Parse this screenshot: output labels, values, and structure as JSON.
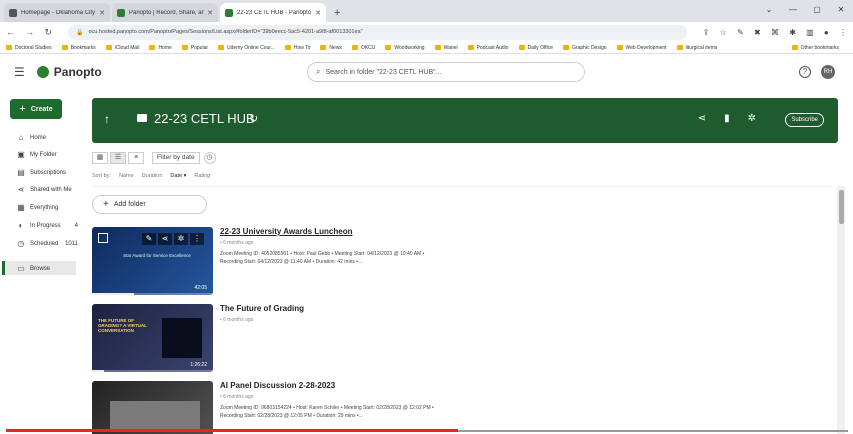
{
  "browser": {
    "tabs": [
      {
        "label": "Homepage - Oklahoma City Univ",
        "color": "#555"
      },
      {
        "label": "Panopto | Record, Share, and Ma",
        "color": "#2e7d32"
      },
      {
        "label": "22-23 CETL HUB - Panopto",
        "color": "#2e7d32",
        "active": true
      }
    ],
    "new_tab": "+",
    "window_controls": [
      "⌄",
      "—",
      "▢",
      "✕"
    ],
    "url": "ocu.hosted.panopto.com/Panopto/Pages/Sessions/List.aspx#folderID=\"39b0eecc-5ac5-4201-a9f8-af0013301ea\"",
    "bookmarks": [
      "Doctoral Studies",
      "Bookmarks",
      "iCloud Mail",
      "Home",
      "Popular",
      "Udemy Online Cour...",
      "How To",
      "News",
      "OKCU",
      "Woodworking",
      "Wanel",
      "Podcast Audio",
      "Daily Office",
      "Graphic Design",
      "Web Development",
      "liturgical items"
    ],
    "other_bookmarks": "Other bookmarks"
  },
  "header": {
    "logo": "Panopto",
    "search_placeholder": "Search in folder \"22-23 CETL HUB\"...",
    "help": "?",
    "avatar": "RH"
  },
  "sidebar": {
    "create": "Create",
    "items": [
      {
        "label": "Home",
        "icon": "⌂",
        "count": ""
      },
      {
        "label": "My Folder",
        "icon": "▣",
        "count": ""
      },
      {
        "label": "Subscriptions",
        "icon": "▤",
        "count": ""
      },
      {
        "label": "Shared with Me",
        "icon": "⋖",
        "count": ""
      },
      {
        "label": "Everything",
        "icon": "▦",
        "count": ""
      },
      {
        "label": "In Progress",
        "icon": "◐",
        "count": "4"
      },
      {
        "label": "Scheduled",
        "icon": "◷",
        "count": "1011"
      },
      {
        "label": "Browse",
        "icon": "▭",
        "count": ""
      }
    ]
  },
  "folder": {
    "title": "22-23 CETL HUB",
    "subscribe": "Subscribe"
  },
  "toolbar": {
    "filter_by_date": "Filter by date",
    "sort_by": "Sort by:",
    "sort_options": [
      "Name",
      "Duration",
      "Date ▾",
      "Rating"
    ]
  },
  "add_folder": "Add folder",
  "sessions": [
    {
      "title": "22-23 University Awards Luncheon",
      "ago": "• 6 months ago",
      "meta": "Zoom Meeting ID: 4052085561 • Host: Paul Gebb • Meeting Start: 04/12/2023 @ 10:40 AM • Recording Start: 04/12/2023 @ 11:40 AM • Duration: 42 mins •...",
      "duration": "42:05",
      "thumb_text": "Star Award for Service Excellence",
      "thumb_color": "#1a3e74",
      "progress": 0.35
    },
    {
      "title": "The Future of Grading",
      "ago": "• 6 months ago",
      "meta": "",
      "duration": "1:26:22",
      "thumb_text": "THE FUTURE OF GRADING? A VIRTUAL CONVERSATION",
      "thumb_color": "#2a2f4a",
      "progress": 0.1
    },
    {
      "title": "AI Panel Discussion 2-28-2023",
      "ago": "• 6 months ago",
      "meta": "Zoom Meeting ID: 96803154224 • Host: Karen Schiler • Meeting Start: 02/28/2023 @ 12:02 PM • Recording Start: 02/28/2023 @ 12:05 PM • Duration: 29 mins •...",
      "duration": "",
      "thumb_text": "",
      "thumb_color": "#3a3a3a",
      "progress": 0.0
    }
  ]
}
